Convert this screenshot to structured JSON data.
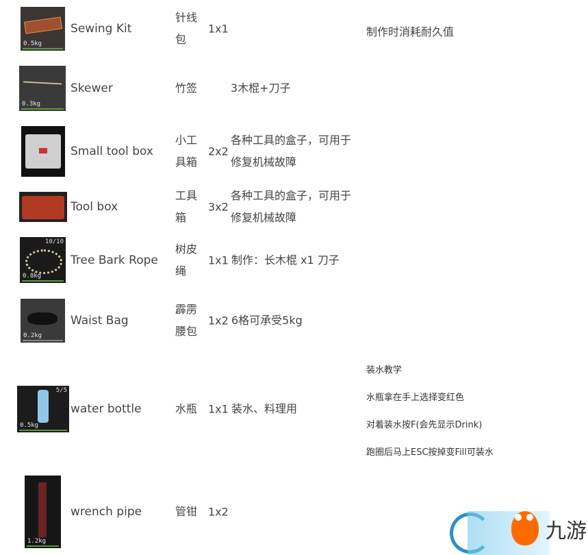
{
  "items": [
    {
      "name": "Sewing Kit",
      "cn": "针线包",
      "size": "1x1",
      "desc": "",
      "note": "制作时消耗耐久值",
      "weight": "0.5kg"
    },
    {
      "name": "Skewer",
      "cn": "竹签",
      "size": "",
      "desc": "3木棍+刀子",
      "weight": "0.3kg"
    },
    {
      "name": "Small tool box",
      "cn": "小工具箱",
      "size": "2x2",
      "desc": "各种工具的盒子，可用于修复机械故障",
      "weight": ""
    },
    {
      "name": "Tool box",
      "cn": "工具箱",
      "size": "3x2",
      "desc": "各种工具的盒子，可用于修复机械故障",
      "weight": ""
    },
    {
      "name": "Tree Bark Rope",
      "cn": "树皮绳",
      "size": "1x1",
      "desc": "制作：长木棍 x1 刀子",
      "weight": "0.8kg",
      "count": "10/10"
    },
    {
      "name": "Waist Bag",
      "cn": "霹雳腰包",
      "size": "1x2",
      "desc": "6格可承受5kg",
      "weight": "0.2kg"
    },
    {
      "name": "water bottle",
      "cn": "水瓶",
      "size": "1x1",
      "desc": "装水、料理用",
      "weight": "0.5kg",
      "count": "5/5",
      "notes": [
        "装水教学",
        "水瓶拿在手上选择变红色",
        "对着装水按F(会先显示Drink)",
        "跑圈后马上ESC按掉变Fill可装水"
      ]
    },
    {
      "name": "wrench pipe",
      "cn": "管钳",
      "size": "1x2",
      "desc": "",
      "weight": "1.2kg"
    }
  ],
  "watermark": {
    "text": "九游",
    "brand_color": "#ff6a00"
  }
}
